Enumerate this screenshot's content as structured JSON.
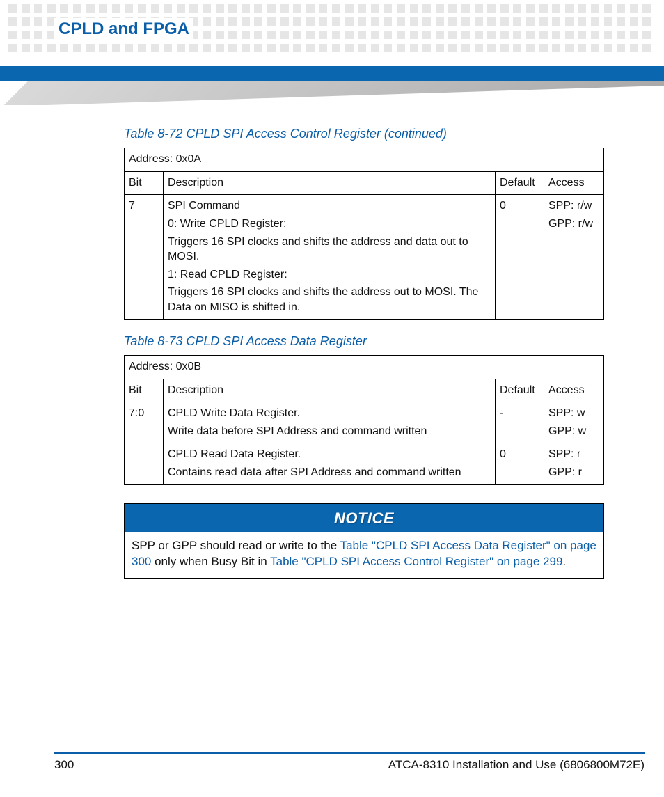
{
  "chapter_title": "CPLD and FPGA",
  "table72": {
    "caption": "Table 8-72 CPLD SPI Access Control Register (continued)",
    "address_line": "Address: 0x0A",
    "headers": {
      "bit": "Bit",
      "desc": "Description",
      "def": "Default",
      "acc": "Access"
    },
    "rows": [
      {
        "bit": "7",
        "desc": [
          "SPI Command",
          "0: Write CPLD Register:",
          "Triggers 16 SPI clocks and shifts the address and data out to MOSI.",
          "1: Read CPLD Register:",
          "Triggers 16 SPI clocks and shifts the address out to MOSI. The Data on MISO is shifted in."
        ],
        "def": "0",
        "acc": [
          "SPP: r/w",
          "GPP: r/w"
        ]
      }
    ]
  },
  "table73": {
    "caption": "Table 8-73 CPLD SPI Access Data Register",
    "address_line": "Address: 0x0B",
    "headers": {
      "bit": "Bit",
      "desc": "Description",
      "def": "Default",
      "acc": "Access"
    },
    "rows": [
      {
        "bit": "7:0",
        "desc": [
          "CPLD Write Data Register.",
          "Write data before SPI Address and command written"
        ],
        "def": "-",
        "acc": [
          "SPP: w",
          "GPP: w"
        ]
      },
      {
        "bit": "",
        "desc": [
          "CPLD Read Data Register.",
          "Contains read data after SPI Address and command written"
        ],
        "def": "0",
        "acc": [
          "SPP: r",
          "GPP: r"
        ]
      }
    ]
  },
  "notice": {
    "label": "NOTICE",
    "text_pre": "SPP or GPP should read or write to the ",
    "link1": "Table \"CPLD SPI Access Data Register\" on page 300",
    "text_mid": " only when Busy Bit in ",
    "link2": "Table \"CPLD SPI Access Control Register\" on page 299",
    "text_post": "."
  },
  "footer": {
    "page": "300",
    "doc": "ATCA-8310 Installation and Use (6806800M72E)"
  }
}
